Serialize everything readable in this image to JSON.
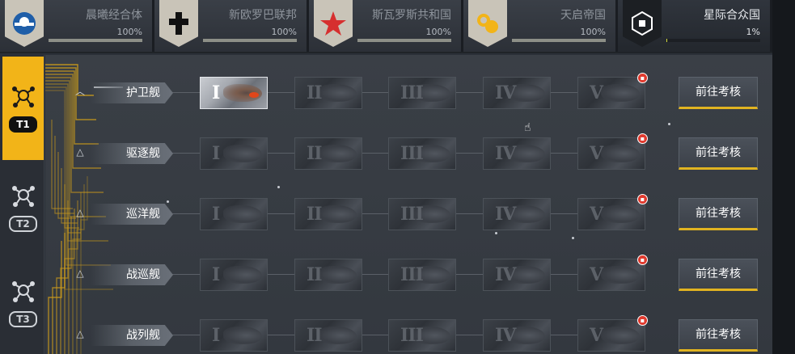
{
  "factions": [
    {
      "name": "晨曦经合体",
      "percent": "100%",
      "progress": 1.0,
      "emblem": "sunrise-emblem-icon"
    },
    {
      "name": "新欧罗巴联邦",
      "percent": "100%",
      "progress": 1.0,
      "emblem": "cross-emblem-icon"
    },
    {
      "name": "斯瓦罗斯共和国",
      "percent": "100%",
      "progress": 1.0,
      "emblem": "star-emblem-icon"
    },
    {
      "name": "天启帝国",
      "percent": "100%",
      "progress": 1.0,
      "emblem": "circles-emblem-icon"
    },
    {
      "name": "星际合众国",
      "percent": "1%",
      "progress": 0.01,
      "emblem": "hexagon-emblem-icon",
      "active": true
    }
  ],
  "tiers": [
    {
      "label": "T1",
      "active": true
    },
    {
      "label": "T2",
      "active": false
    },
    {
      "label": "T3",
      "active": false
    }
  ],
  "ship_levels": [
    "I",
    "II",
    "III",
    "IV",
    "V"
  ],
  "rows": [
    {
      "class_name": "护卫舰",
      "button": "前往考核",
      "unlocked": 1
    },
    {
      "class_name": "驱逐舰",
      "button": "前往考核",
      "unlocked": 0
    },
    {
      "class_name": "巡洋舰",
      "button": "前往考核",
      "unlocked": 0
    },
    {
      "class_name": "战巡舰",
      "button": "前往考核",
      "unlocked": 0
    },
    {
      "class_name": "战列舰",
      "button": "前往考核",
      "unlocked": 0
    }
  ],
  "colors": {
    "accent": "#f2b418",
    "active_progress": "#d6dd3a",
    "gift_badge": "#e03a2e"
  }
}
